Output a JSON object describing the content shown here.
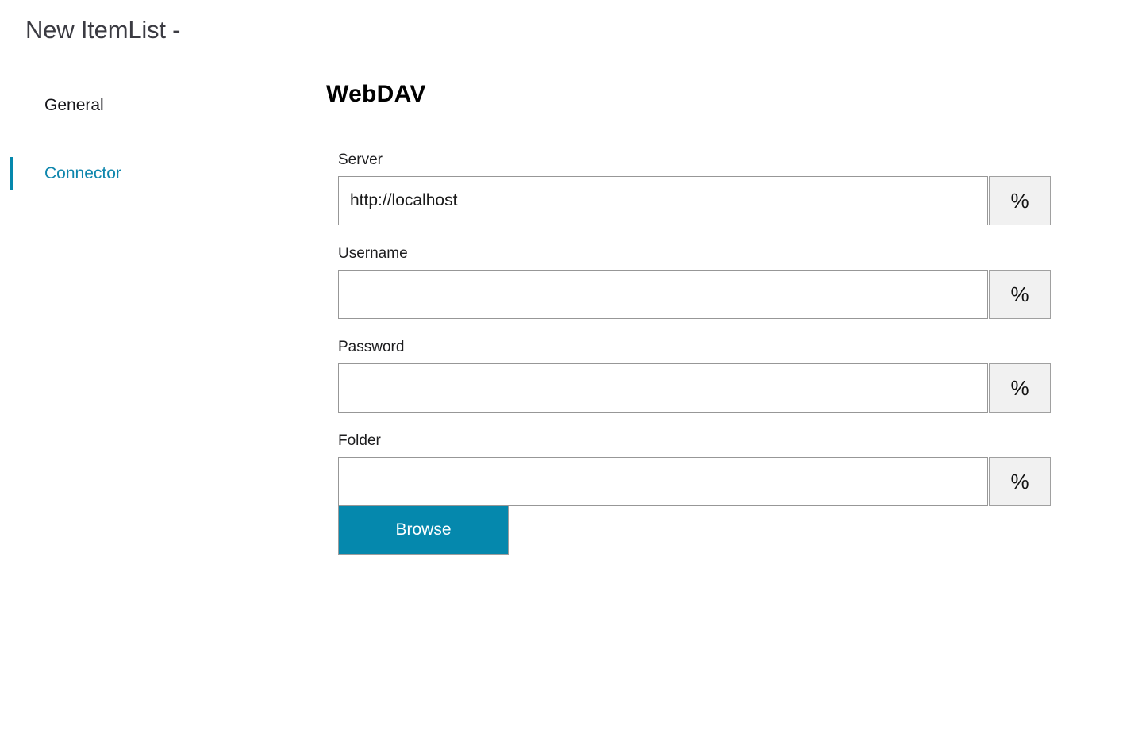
{
  "dialog": {
    "title": "New ItemList -"
  },
  "theme": {
    "accent": "#0588ad",
    "accent_text": "#0e86ad",
    "field_border": "#979797",
    "token_fill": "#f1f1f1",
    "background": "#ffffff",
    "title_color": "#3b3b42"
  },
  "sidebar": {
    "items": [
      {
        "label": "General",
        "active": false
      },
      {
        "label": "Connector",
        "active": true
      }
    ]
  },
  "main": {
    "heading": "WebDAV",
    "fields": [
      {
        "label": "Server",
        "value": "http://localhost",
        "placeholder": "",
        "token_label": "%",
        "token_icon": "percent-icon"
      },
      {
        "label": "Username",
        "value": "",
        "placeholder": "",
        "token_label": "%",
        "token_icon": "percent-icon"
      },
      {
        "label": "Password",
        "value": "",
        "placeholder": "",
        "token_label": "%",
        "token_icon": "percent-icon"
      },
      {
        "label": "Folder",
        "value": "",
        "placeholder": "",
        "token_label": "%",
        "token_icon": "percent-icon"
      }
    ],
    "browse_label": "Browse"
  }
}
